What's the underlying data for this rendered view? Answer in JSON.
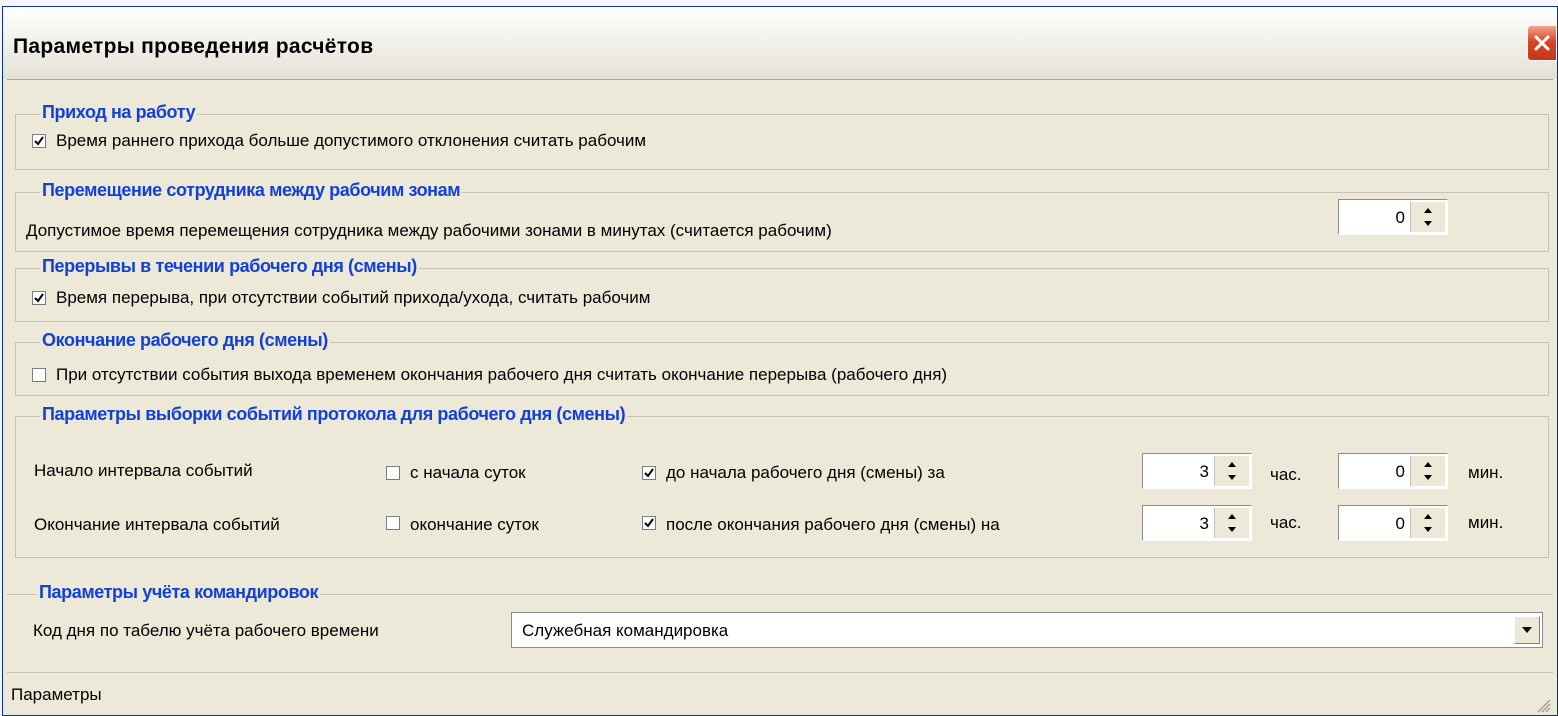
{
  "window": {
    "title": "Параметры проведения расчётов"
  },
  "groups": {
    "arrival": {
      "title": "Приход на работу",
      "early_arrival": {
        "label": "Время раннего прихода больше допустимого отклонения считать рабочим",
        "checked": true
      }
    },
    "movement": {
      "title": "Перемещение сотрудника между рабочим зонам",
      "label": "Допустимое время перемещения сотрудника между рабочими зонами в минутах (считается рабочим)",
      "minutes": "0"
    },
    "breaks": {
      "title": "Перерывы в течении рабочего дня (смены)",
      "break_time": {
        "label": "Время перерыва, при отсутствии событий прихода/ухода, считать рабочим",
        "checked": true
      }
    },
    "end_of_day": {
      "title": "Окончание рабочего дня (смены)",
      "no_exit": {
        "label": "При отсутствии события выхода временем окончания рабочего дня считать окончание перерыва (рабочего дня)",
        "checked": false
      }
    },
    "protocol": {
      "title": "Параметры выборки событий протокола для рабочего дня (смены)",
      "start": {
        "label": "Начало интервала событий",
        "from_day_start": {
          "label": "с начала суток",
          "checked": false
        },
        "before_shift": {
          "label": "до начала рабочего дня (смены) за",
          "checked": true
        },
        "hours": "3",
        "hours_unit": "час.",
        "minutes": "0",
        "minutes_unit": "мин."
      },
      "end": {
        "label": "Окончание интервала событий",
        "day_end": {
          "label": "окончание суток",
          "checked": false
        },
        "after_shift": {
          "label": "после окончания рабочего дня (смены) на",
          "checked": true
        },
        "hours": "3",
        "hours_unit": "час.",
        "minutes": "0",
        "minutes_unit": "мин."
      }
    },
    "business_trip": {
      "title": "Параметры учёта командировок",
      "label": "Код дня по табелю учёта рабочего времени",
      "value": "Служебная командировка"
    }
  },
  "status_bar": {
    "text": "Параметры"
  },
  "colors": {
    "group_title": "#1240d8",
    "window_bg": "#ece9d8",
    "close_button": "#d9462a"
  }
}
